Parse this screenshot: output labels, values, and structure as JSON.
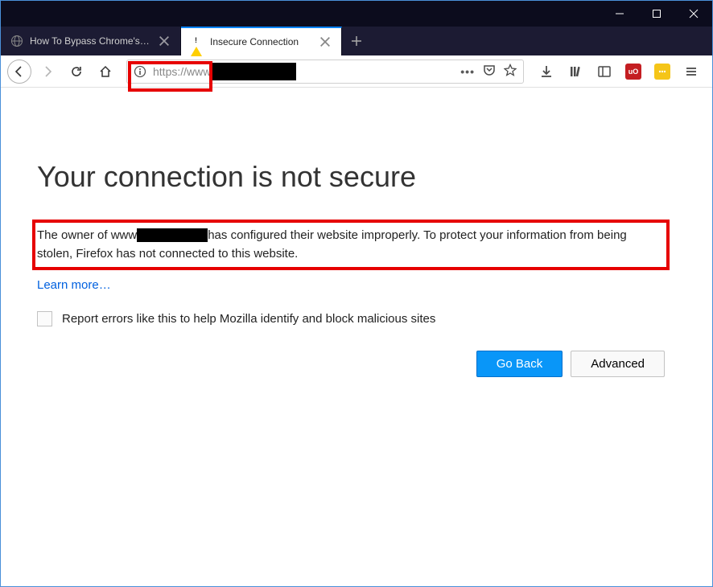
{
  "window": {
    "controls": {
      "minimize": "minimize",
      "maximize": "maximize",
      "close": "close"
    }
  },
  "tabs": {
    "items": [
      {
        "title": "How To Bypass Chrome's HSTS Wa",
        "favicon": "globe",
        "active": false
      },
      {
        "title": "Insecure Connection",
        "favicon": "warning",
        "active": true
      }
    ],
    "new_tab": "+"
  },
  "toolbar": {
    "back": "back",
    "forward": "forward",
    "reload": "reload",
    "home": "home",
    "url_prefix": "https://www",
    "url_redacted": true,
    "page_actions": {
      "menu": "…",
      "pocket": "pocket",
      "bookmark": "star"
    },
    "icons": {
      "downloads": "download",
      "library": "library",
      "reader": "sidebar",
      "ublock": "shield",
      "ext": "badge",
      "menu": "hamburger"
    }
  },
  "page": {
    "title": "Your connection is not secure",
    "para_pre": "The owner of www",
    "para_post": "has configured their website improperly. To protect your information from being stolen, Firefox has not connected to this website.",
    "learn_more": "Learn more…",
    "checkbox_label": "Report errors like this to help Mozilla identify and block malicious sites",
    "go_back": "Go Back",
    "advanced": "Advanced"
  }
}
